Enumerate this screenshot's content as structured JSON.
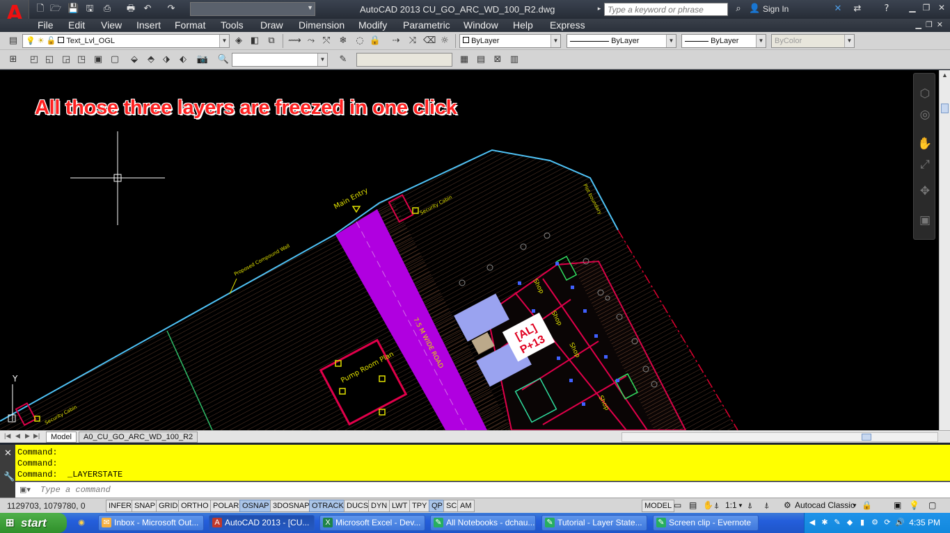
{
  "titlebar": {
    "app_title": "AutoCAD 2013    CU_GO_ARC_WD_100_R2.dwg",
    "search_placeholder": "Type a keyword or phrase",
    "sign_in": "Sign In"
  },
  "menu": {
    "items": [
      "File",
      "Edit",
      "View",
      "Insert",
      "Format",
      "Tools",
      "Draw",
      "Dimension",
      "Modify",
      "Parametric",
      "Window",
      "Help",
      "Express"
    ]
  },
  "toolbar": {
    "layer_name": "Text_Lvl_OGL",
    "color": "ByLayer",
    "linetype": "ByLayer",
    "lineweight": "ByLayer",
    "plotstyle": "ByColor"
  },
  "drawing": {
    "annotation": "All those three layers are freezed in one click",
    "labels": {
      "main_entry": "Main Entry",
      "security_cabin": "Security Cabin",
      "compound_wall": "Proposed Compound Wall",
      "road": "7.5 M WIDE ROAD",
      "pump_room": "Pump Room Plan",
      "tag_line1": "[AL]",
      "tag_line2": "P+13",
      "shop": "Shop",
      "ucs_y": "Y",
      "plot_boundary": "Plot boundary"
    }
  },
  "tabs": {
    "model": "Model",
    "layout": "A0_CU_GO_ARC_WD_100_R2"
  },
  "command": {
    "history": [
      "Command:",
      "Command:",
      "Command:  _LAYERSTATE"
    ],
    "placeholder": "Type a command"
  },
  "status": {
    "coordinates": "1129703, 1079780, 0",
    "toggles": [
      {
        "label": "INFER",
        "on": false
      },
      {
        "label": "SNAP",
        "on": false
      },
      {
        "label": "GRID",
        "on": false
      },
      {
        "label": "ORTHO",
        "on": false
      },
      {
        "label": "POLAR",
        "on": false
      },
      {
        "label": "OSNAP",
        "on": true
      },
      {
        "label": "3DOSNAP",
        "on": false
      },
      {
        "label": "OTRACK",
        "on": true
      },
      {
        "label": "DUCS",
        "on": false
      },
      {
        "label": "DYN",
        "on": false
      },
      {
        "label": "LWT",
        "on": false
      },
      {
        "label": "TPY",
        "on": false
      },
      {
        "label": "QP",
        "on": true
      },
      {
        "label": "SC",
        "on": false
      },
      {
        "label": "AM",
        "on": false
      }
    ],
    "model": "MODEL",
    "scale": "1:1",
    "workspace": "Autocad Classic"
  },
  "taskbar": {
    "start": "start",
    "tasks": [
      "Inbox - Microsoft Out...",
      "AutoCAD 2013 - [CU...",
      "Microsoft Excel - Dev...",
      "All Notebooks - dchau...",
      "Tutorial - Layer State...",
      "Screen clip - Evernote"
    ],
    "clock": "4:35 PM"
  },
  "colors": {
    "command_bg": "#ffff00",
    "annotation": "#ff2020",
    "road": "#b000e0",
    "boundary": "#4fc3f7",
    "walls": "#e0004a"
  }
}
